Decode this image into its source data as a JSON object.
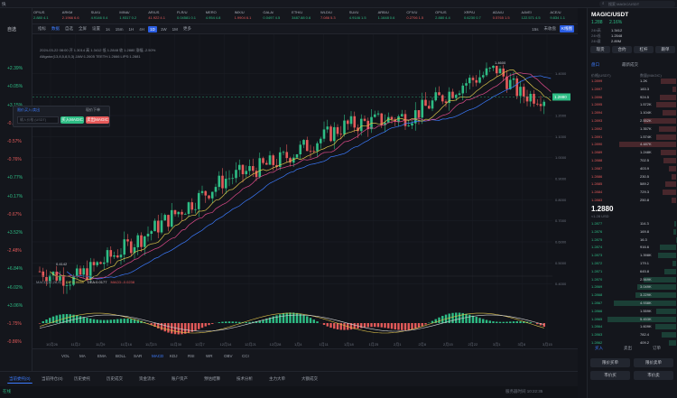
{
  "app": {
    "search_placeholder": "搜索 MAGIC/USDT",
    "pair": "MAGIC/USDT"
  },
  "tickers": [
    {
      "name": "OP/US",
      "price": "2.880",
      "chg": "4.1"
    },
    {
      "name": "ARKM",
      "price": "2.1966",
      "chg": "6.6"
    },
    {
      "name": "SUI/U",
      "price": "4.9146",
      "chg": "0.4"
    },
    {
      "name": "MINA/",
      "price": "1.9317",
      "chg": "0.2"
    },
    {
      "name": "AR/US",
      "price": "41.922",
      "chg": "4.1"
    },
    {
      "name": "FLR/U",
      "price": "0.04581",
      "chg": "0.1"
    },
    {
      "name": "MERO",
      "price": "4.954",
      "chg": "4.8"
    },
    {
      "name": "IMX/U",
      "price": "1.9904",
      "chg": "6.1"
    },
    {
      "name": "GALA/",
      "price": "0.0497",
      "chg": "4.5"
    },
    {
      "name": "ETH/U",
      "price": "3487.88",
      "chg": "0.6"
    },
    {
      "name": "WLD/U",
      "price": "7.086",
      "chg": "5.3"
    },
    {
      "name": "SUI/U",
      "price": "4.9146",
      "chg": "1.5"
    },
    {
      "name": "ARB/U",
      "price": "1.1648",
      "chg": "0.6"
    },
    {
      "name": "CFX/U",
      "price": "0.2706",
      "chg": "1.5"
    },
    {
      "name": "OP/US",
      "price": "2.880",
      "chg": "4.4"
    },
    {
      "name": "XRP/U",
      "price": "0.6230",
      "chg": "0.7"
    },
    {
      "name": "ADA/U",
      "price": "0.5765",
      "chg": "1.5"
    },
    {
      "name": "AAVE/",
      "price": "122.571",
      "chg": "4.5"
    },
    {
      "name": "ACE/U",
      "price": "9.834",
      "chg": "1.1"
    }
  ],
  "left_list": [
    "自选",
    "+2.39%",
    "+0.05%",
    "+3.15%",
    "-0.14%",
    "-0.57%",
    "-0.76%",
    "+0.77%",
    "+0.17%",
    "-0.67%",
    "+3.52%",
    "-2.48%",
    "+6.84%",
    "+6.02%",
    "+3.06%",
    "-1.75%",
    "-0.86%"
  ],
  "toolbar": [
    "指标",
    "数据",
    "自选",
    "全屏",
    "设置",
    "1s",
    "15m",
    "1H",
    "4H",
    "1D",
    "1W",
    "1M",
    "更多"
  ],
  "right_toolbar": {
    "interval": "15s",
    "pair_tag": "K线图",
    "setting": "未收盘"
  },
  "legend1": "2024-03-22 08:00 开 1.3014 高 1.3412 低 1.2848 收 1.2880 涨幅 -2.50%",
  "legend2": "Alligator(13,8,5,8,5,3)  JAW:1.2605  TEETH:1.2666  LIPS:1.2881",
  "macd_legend": {
    "label": "MACD(12,26,9)",
    "dif": "DIF:0.0058",
    "dea": "DEA:0.0177",
    "macd": "MACD:-0.0238"
  },
  "order_panel": {
    "title": "限价买入/卖出",
    "input_placeholder": "输入价格 (USDT)",
    "market": "现价下单",
    "buy": "买入MAGIC",
    "sell": "卖出MAGIC"
  },
  "price_axis": [
    "1.4000",
    "1.3000",
    "1.2000",
    "1.1000",
    "1.0000",
    "0.9000",
    "0.8000",
    "0.7000",
    "0.6000",
    "0.5000",
    "0.4000"
  ],
  "last_price_tag": "1.2880",
  "high_label": "1.4600",
  "low_label": "0.4142",
  "date_axis": [
    "10月26",
    "11月2",
    "11月9",
    "11月16",
    "11月23",
    "11月30",
    "12月7",
    "12月14",
    "12月21",
    "12月28",
    "1月4",
    "1月11",
    "1月18",
    "1月25",
    "2月1",
    "2月8",
    "2月15",
    "2月22",
    "3月1",
    "3月8",
    "3月15"
  ],
  "bottom_indicators": [
    "VOL",
    "MA",
    "EMA",
    "BOLL",
    "SAR",
    "MACD",
    "KDJ",
    "RSI",
    "WR",
    "OBV",
    "CCI"
  ],
  "bottom_tabs": [
    "当前委托(0)",
    "当前持仓(0)",
    "历史委托",
    "历史成交",
    "资金流水",
    "账户资产",
    "预估结算",
    "技术分析",
    "主力大单",
    "大额成交"
  ],
  "status": {
    "left": "在线",
    "right": "服务器时间 10:22:35"
  },
  "right_panel": {
    "price": "1.288",
    "change": "2.16%",
    "stats": [
      [
        "24h高",
        "1.3412"
      ],
      [
        "24h低",
        "1.2548"
      ],
      [
        "24h量",
        "2.89M"
      ]
    ],
    "buttons": [
      "现货",
      "合约",
      "杠杆",
      "跟单"
    ],
    "tabs": [
      "盘口",
      "最新成交"
    ],
    "book_header": [
      "价格(USDT)",
      "数量(MAGIC)"
    ],
    "asks": [
      [
        "1.2899",
        "1.2K"
      ],
      [
        "1.2897",
        "183.3"
      ],
      [
        "1.2896",
        "924.5"
      ],
      [
        "1.2895",
        "1.572K"
      ],
      [
        "1.2894",
        "1.104K"
      ],
      [
        "1.2893",
        "2.552K"
      ],
      [
        "1.2892",
        "1.357K"
      ],
      [
        "1.2891",
        "1.574K"
      ],
      [
        "1.2890",
        "4.487K"
      ],
      [
        "1.2889",
        "1.248K"
      ],
      [
        "1.2888",
        "702.5"
      ],
      [
        "1.2887",
        "403.9"
      ],
      [
        "1.2886",
        "230.5"
      ],
      [
        "1.2885",
        "589.2"
      ],
      [
        "1.2884",
        "729.3"
      ],
      [
        "1.2883",
        "250.8"
      ]
    ],
    "mid_price": "1.2880",
    "mid_sub": "≈1.28 USD",
    "bids": [
      [
        "1.2877",
        "114.3"
      ],
      [
        "1.2876",
        "169.8"
      ],
      [
        "1.2875",
        "16.3"
      ],
      [
        "1.2874",
        "916.6"
      ],
      [
        "1.2873",
        "1.398K"
      ],
      [
        "1.2872",
        "179.1"
      ],
      [
        "1.2871",
        "645.8"
      ],
      [
        "1.2870",
        "2.569K"
      ],
      [
        "1.2869",
        "3.049K"
      ],
      [
        "1.2868",
        "3.229K"
      ],
      [
        "1.2867",
        "4.938K"
      ],
      [
        "1.2866",
        "1.559K"
      ],
      [
        "1.2865",
        "5.453K"
      ],
      [
        "1.2864",
        "1.609K"
      ],
      [
        "1.2863",
        "782.4"
      ],
      [
        "1.2862",
        "409.2"
      ]
    ],
    "trade_tabs": [
      "买入",
      "卖出",
      "订单"
    ],
    "bottom_buttons": [
      "限价买单",
      "限价卖单",
      "市价买",
      "市价卖"
    ]
  },
  "colors": {
    "up": "#2ebd85",
    "down": "#e55a5a",
    "accent": "#2b5ee3",
    "bg": "#12141a"
  }
}
